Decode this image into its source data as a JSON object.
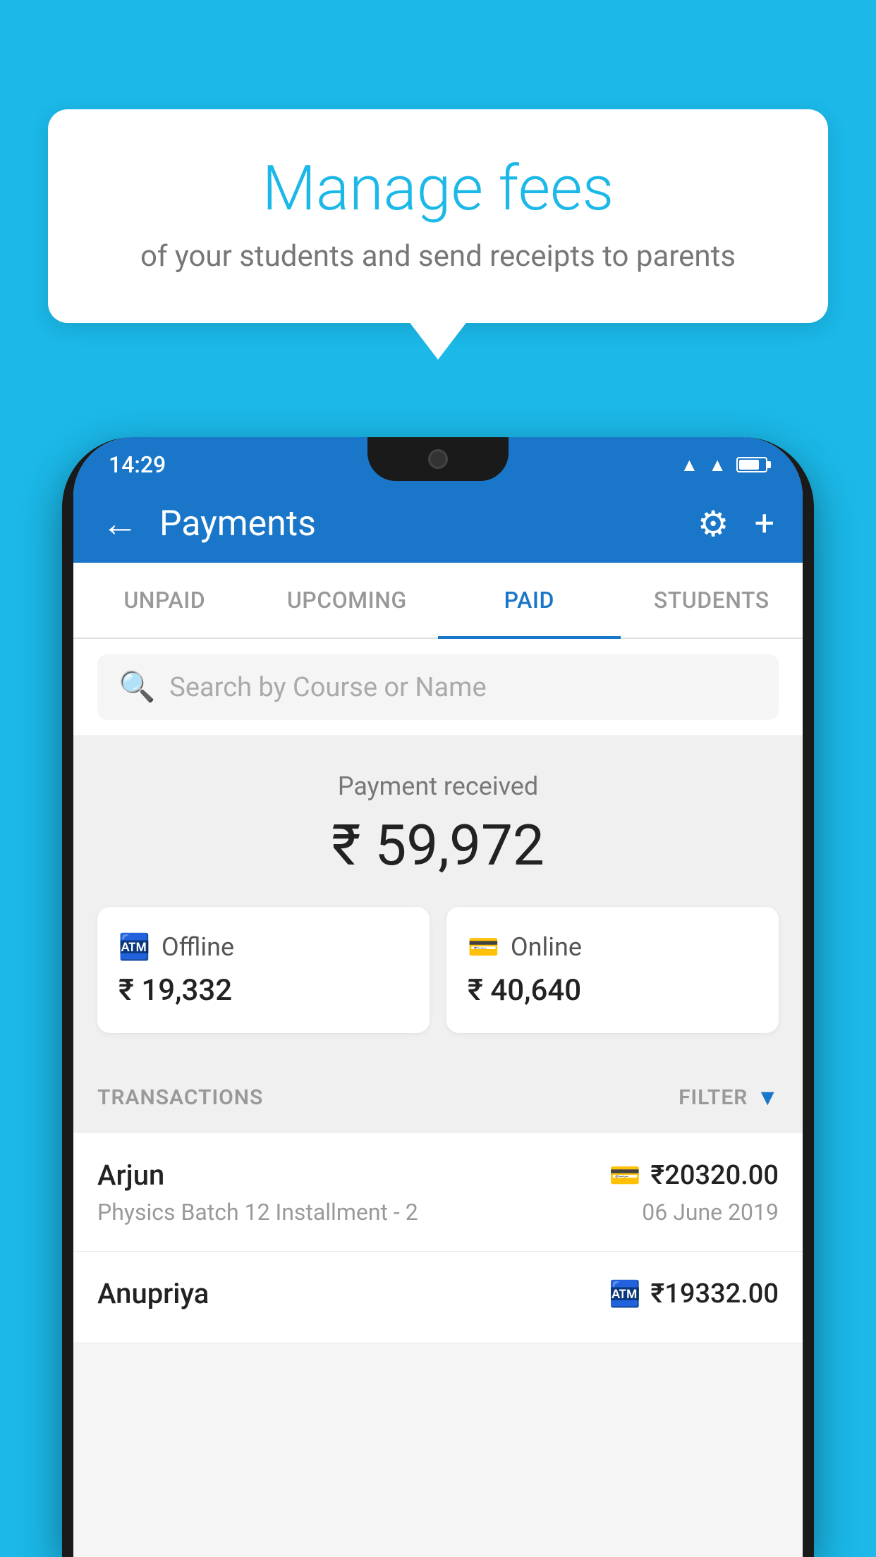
{
  "background_color": "#1bb8e8",
  "bubble": {
    "title": "Manage fees",
    "subtitle": "of your students and send receipts to parents"
  },
  "status_bar": {
    "time": "14:29"
  },
  "app_bar": {
    "title": "Payments",
    "back_label": "←",
    "gear_label": "⚙",
    "plus_label": "+"
  },
  "tabs": [
    {
      "label": "UNPAID",
      "active": false
    },
    {
      "label": "UPCOMING",
      "active": false
    },
    {
      "label": "PAID",
      "active": true
    },
    {
      "label": "STUDENTS",
      "active": false
    }
  ],
  "search": {
    "placeholder": "Search by Course or Name"
  },
  "payment_summary": {
    "label": "Payment received",
    "amount": "₹ 59,972",
    "offline": {
      "type": "Offline",
      "amount": "₹ 19,332"
    },
    "online": {
      "type": "Online",
      "amount": "₹ 40,640"
    }
  },
  "transactions": {
    "label": "TRANSACTIONS",
    "filter_label": "FILTER",
    "items": [
      {
        "name": "Arjun",
        "detail": "Physics Batch 12 Installment - 2",
        "amount": "₹20320.00",
        "date": "06 June 2019",
        "icon": "card"
      },
      {
        "name": "Anupriya",
        "detail": "",
        "amount": "₹19332.00",
        "date": "",
        "icon": "cash"
      }
    ]
  }
}
